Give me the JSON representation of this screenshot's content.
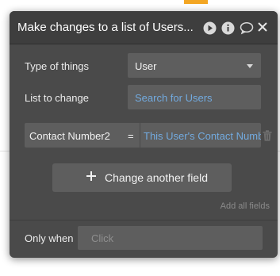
{
  "dialog": {
    "title": "Make changes to a list of Users...",
    "icons": [
      "play-icon",
      "info-icon",
      "comment-icon",
      "close-icon"
    ]
  },
  "type_of_things": {
    "label": "Type of things",
    "value": "User"
  },
  "list_to_change": {
    "label": "List to change",
    "value": "Search for Users"
  },
  "field_change": {
    "key": "Contact Number2",
    "operator": "=",
    "value": "This User's Contact Number"
  },
  "add_field_button": {
    "label": "Change another field"
  },
  "add_all_fields": {
    "label": "Add all fields"
  },
  "only_when": {
    "label": "Only when",
    "placeholder": "Click"
  },
  "colors": {
    "panel_bg": "#4a4a4a",
    "field_bg": "#5e5e5e",
    "link": "#72aadf",
    "accent": "#f3a623"
  }
}
